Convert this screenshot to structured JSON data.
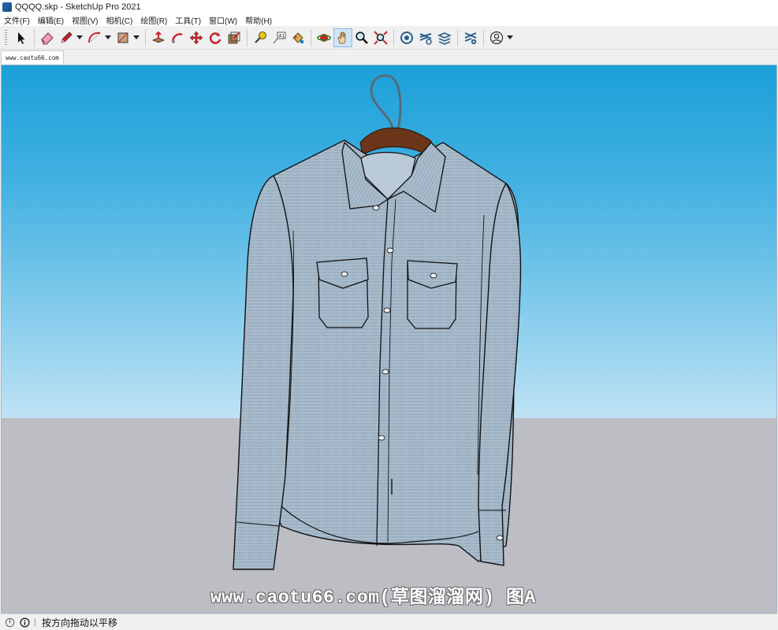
{
  "window": {
    "title": "QQQQ.skp - SketchUp Pro 2021"
  },
  "menu": [
    "文件(F)",
    "编辑(E)",
    "视图(V)",
    "相机(C)",
    "绘图(R)",
    "工具(T)",
    "窗口(W)",
    "帮助(H)"
  ],
  "toolbar": {
    "tools": [
      "select-tool",
      "eraser-tool",
      "line-tool",
      "arc-tool",
      "rectangle-tool",
      "push-pull-tool",
      "follow-me-tool",
      "move-tool",
      "rotate-tool",
      "scale-tool",
      "tape-measure-tool",
      "text-tool",
      "paint-bucket-tool",
      "orbit-tool",
      "pan-tool",
      "zoom-tool",
      "zoom-extents-tool",
      "3d-warehouse",
      "extension-warehouse",
      "layout",
      "extension-manager",
      "account"
    ],
    "active_tool": "pan-tool"
  },
  "scene_tabs": [
    {
      "label": "www.caotu66.com"
    }
  ],
  "viewport": {
    "sky_color": "#1aa0d8",
    "ground_color": "#bdbdc4",
    "watermark": "www.caotu66.com(草图溜溜网) 图A"
  },
  "status": {
    "message": "按方向拖动以平移"
  }
}
